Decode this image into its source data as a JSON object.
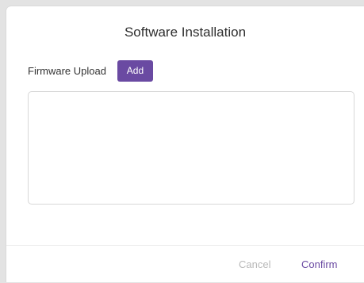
{
  "dialog": {
    "title": "Software Installation"
  },
  "firmware": {
    "label": "Firmware Upload",
    "add_label": "Add"
  },
  "footer": {
    "cancel_label": "Cancel",
    "confirm_label": "Confirm"
  },
  "colors": {
    "accent": "#6a4aa2",
    "background": "#e3e3e3",
    "dialog": "#ffffff",
    "disabled_text": "#b8b8b8"
  }
}
